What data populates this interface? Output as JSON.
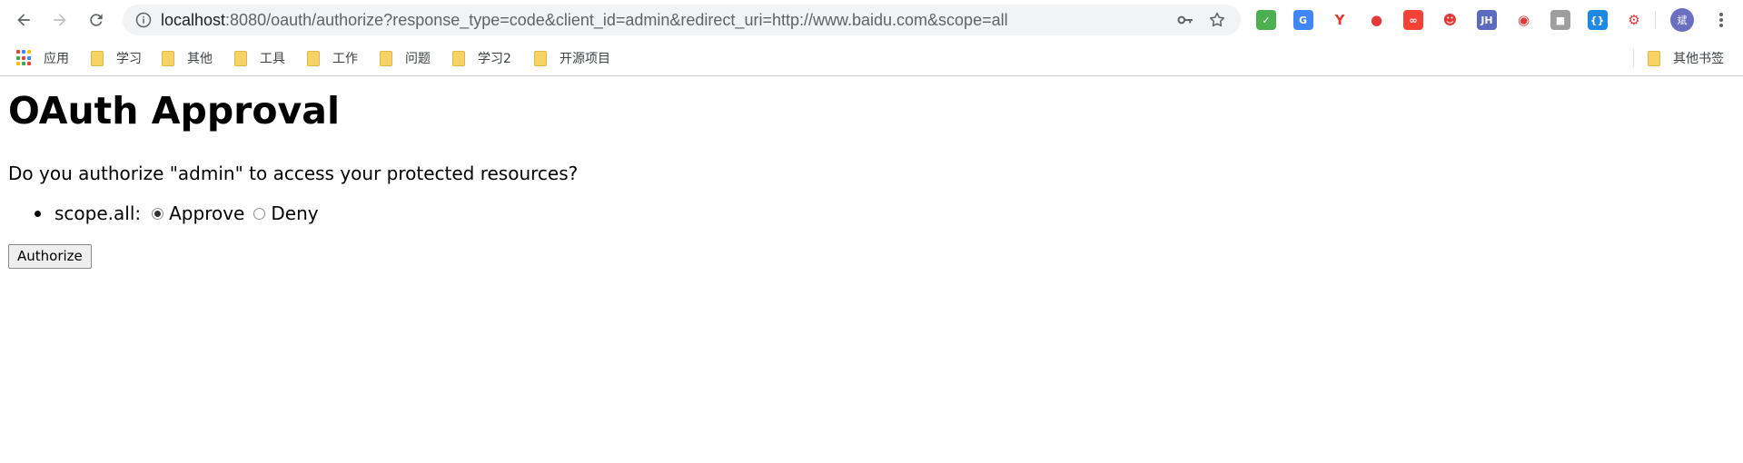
{
  "browser": {
    "url_host": "localhost",
    "url_rest": ":8080/oauth/authorize?response_type=code&client_id=admin&redirect_uri=http://www.baidu.com&scope=all",
    "avatar_text": "斌"
  },
  "extensions": [
    {
      "name": "shield-extension-icon",
      "color": "#4caf50",
      "text": "✓"
    },
    {
      "name": "translate-extension-icon",
      "color": "#4285f4",
      "text": "G"
    },
    {
      "name": "y-extension-icon",
      "color": "#ffffff",
      "text": "Y"
    },
    {
      "name": "red-drop-extension-icon",
      "color": "#ffffff",
      "text": "●"
    },
    {
      "name": "infinity-extension-icon",
      "color": "#f44336",
      "text": "∞"
    },
    {
      "name": "tomcat-extension-icon",
      "color": "#ffffff",
      "text": "☻"
    },
    {
      "name": "jh-extension-icon",
      "color": "#5c6bc0",
      "text": "JH"
    },
    {
      "name": "globe-extension-icon",
      "color": "#ffffff",
      "text": "◉"
    },
    {
      "name": "puzzle-extension-icon",
      "color": "#9e9e9e",
      "text": "■"
    },
    {
      "name": "json-extension-icon",
      "color": "#1e88e5",
      "text": "{}"
    },
    {
      "name": "network-extension-icon",
      "color": "#ffffff",
      "text": "⚙"
    }
  ],
  "bookmarks": {
    "apps_label": "应用",
    "folders": [
      "学习",
      "其他",
      "工具",
      "工作",
      "问题",
      "学习2",
      "开源项目"
    ],
    "other_label": "其他书签"
  },
  "page": {
    "title": "OAuth Approval",
    "question": "Do you authorize \"admin\" to access your protected resources?",
    "scope_label": "scope.all:",
    "approve_label": "Approve",
    "deny_label": "Deny",
    "selected": "Approve",
    "authorize_button": "Authorize"
  }
}
